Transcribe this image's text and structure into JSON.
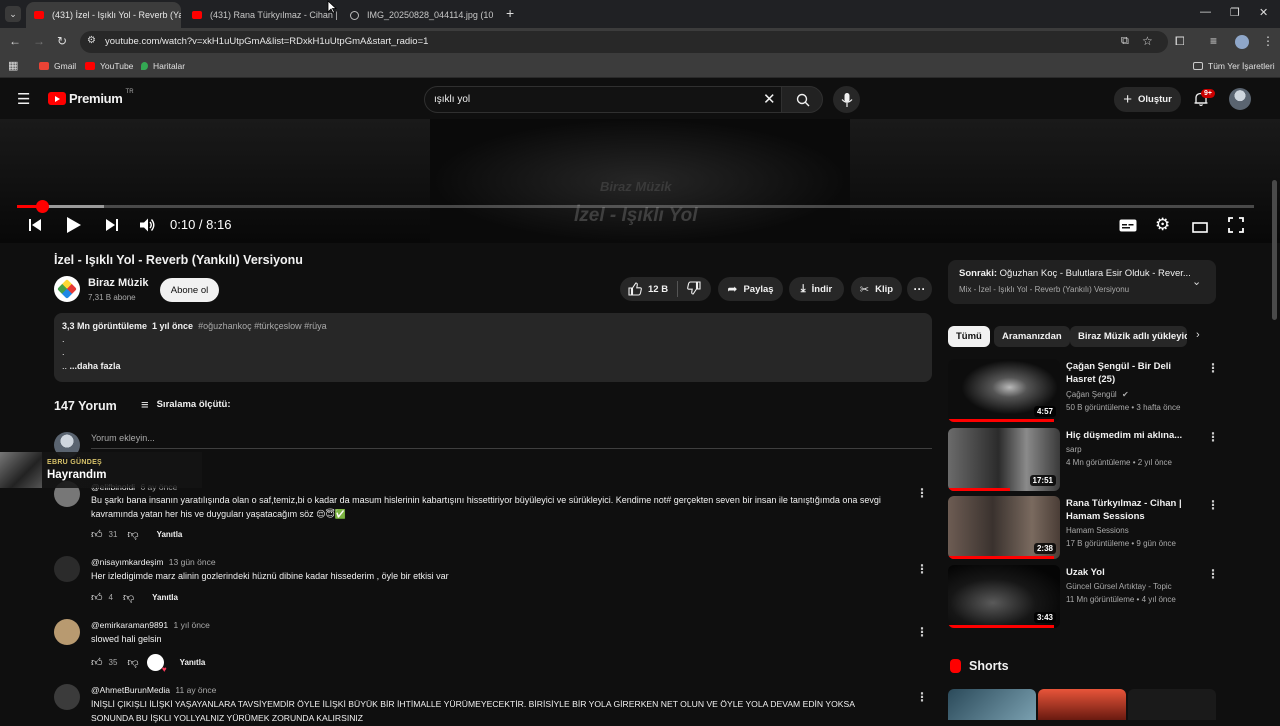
{
  "browser": {
    "tabs": [
      {
        "title": "(431) İzel - Işıklı Yol - Reverb (Ya"
      },
      {
        "title": "(431) Rana Türkyılmaz - Cihan |"
      },
      {
        "title": "IMG_20250828_044114.jpg (10"
      }
    ],
    "url": "youtube.com/watch?v=xkH1uUtpGmA&list=RDxkH1uUtpGmA&start_radio=1",
    "bookmarks": [
      {
        "label": "Gmail",
        "color": "#ea4335"
      },
      {
        "label": "YouTube",
        "color": "#ff0000"
      },
      {
        "label": "Haritalar",
        "color": "#34a853"
      }
    ],
    "all_bookmarks": "Tüm Yer İşaretleri"
  },
  "header": {
    "logo": "Premium",
    "region": "TR",
    "search_value": "ışıklı yol",
    "create_label": "Oluştur",
    "notifications": "9+"
  },
  "player": {
    "overlay_channel": "Biraz Müzik",
    "overlay_title": "İzel - Işıklı Yol",
    "time": "0:10 / 8:16",
    "progress": 0.0204,
    "buffered": 0.07
  },
  "video": {
    "title": "İzel - Işıklı Yol - Reverb (Yankılı) Versiyonu",
    "channel": "Biraz Müzik",
    "subscribers": "7,31 B abone",
    "subscribe_label": "Abone ol",
    "likes": "12 B",
    "share_label": "Paylaş",
    "download_label": "İndir",
    "clip_label": "Klip"
  },
  "description": {
    "views": "3,3 Mn görüntüleme",
    "age": "1 yıl önce",
    "tags": "#oğuzhankoç #türkçeslow #rüya",
    "line1": ".",
    "line2": ".",
    "more_prefix": "..",
    "more_label": "...daha fazla"
  },
  "comments": {
    "count": "147 Yorum",
    "sort_label": "Sıralama ölçütü:",
    "add_placeholder": "Yorum ekleyin...",
    "reply_label": "Yanıtla",
    "items": [
      {
        "author": "@elifbinoldi",
        "time": "6 ay önce",
        "text": "Bu şarkı bana insanın yaratılışında olan o saf,temiz,bi o kadar da masum hislerinin kabartışını hissettiriyor büyüleyici ve sürükleyici. Kendime not# gerçekten seven bir insan ile tanıştığımda ona sevgi",
        "text2": "kavramında yatan her his ve duyguları yaşatacağım  söz 😌😇✅",
        "likes": "31"
      },
      {
        "author": "@nisayımkardeşim",
        "time": "13 gün önce",
        "text": "Her izledigimde marz alinin gozlerindeki hüznü dibine kadar hissederim , öyle bir etkisi var",
        "likes": "4"
      },
      {
        "author": "@emirkaraman9891",
        "time": "1 yıl önce",
        "text": "slowed hali gelsin",
        "likes": "35"
      },
      {
        "author": "@AhmetBurunMedia",
        "time": "11 ay önce",
        "text": "İNİŞLİ ÇIKIŞLI İLİŞKİ YAŞAYANLARA TAVSİYEMDİR ÖYLE İLİŞKİ BÜYÜK BİR İHTİMALLE YÜRÜMEYECEKTİR. BİRİSİYLE BİR YOLA GİRERKEN NET OLUN VE ÖYLE YOLA DEVAM EDİN YOKSA",
        "text2": "SONUNDA BU İŞKLI YOLLYALNIZ YÜRÜMEK ZORUNDA KALIRSINIZ",
        "likes": ""
      }
    ]
  },
  "overlay": {
    "kicker": "EBRU GÜNDEŞ",
    "title": "Hayrandım"
  },
  "sidebar": {
    "next_prefix": "Sonraki:",
    "next_title": "Oğuzhan Koç - Bulutlara Esir Olduk - Rever...",
    "mix_label": "Mix - İzel - Işıklı Yol - Reverb (Yankılı) Versiyonu",
    "chips": [
      "Tümü",
      "Aramanızdan",
      "Biraz Müzik adlı yükleyic"
    ],
    "videos": [
      {
        "title": "Çağan Şengül - Bir Deli Hasret (25)",
        "channel": "Çağan Şengül",
        "meta": "50 B görüntüleme • 3 hafta önce",
        "duration": "4:57",
        "watched": 0.95
      },
      {
        "title": "Hiç düşmedim mi aklına...",
        "channel": "sarp",
        "meta": "4 Mn görüntüleme • 2 yıl önce",
        "duration": "17:51",
        "watched": 0.55
      },
      {
        "title": "Rana Türkyılmaz - Cihan | Hamam Sessions",
        "channel": "Hamam Sessions",
        "meta": "17 B görüntüleme • 9 gün önce",
        "duration": "2:38",
        "watched": 0.95
      },
      {
        "title": "Uzak Yol",
        "channel": "Güncel Gürsel Artıktay - Topic",
        "meta": "11 Mn görüntüleme • 4 yıl önce",
        "duration": "3:43",
        "watched": 0.95
      }
    ],
    "shorts_label": "Shorts"
  }
}
